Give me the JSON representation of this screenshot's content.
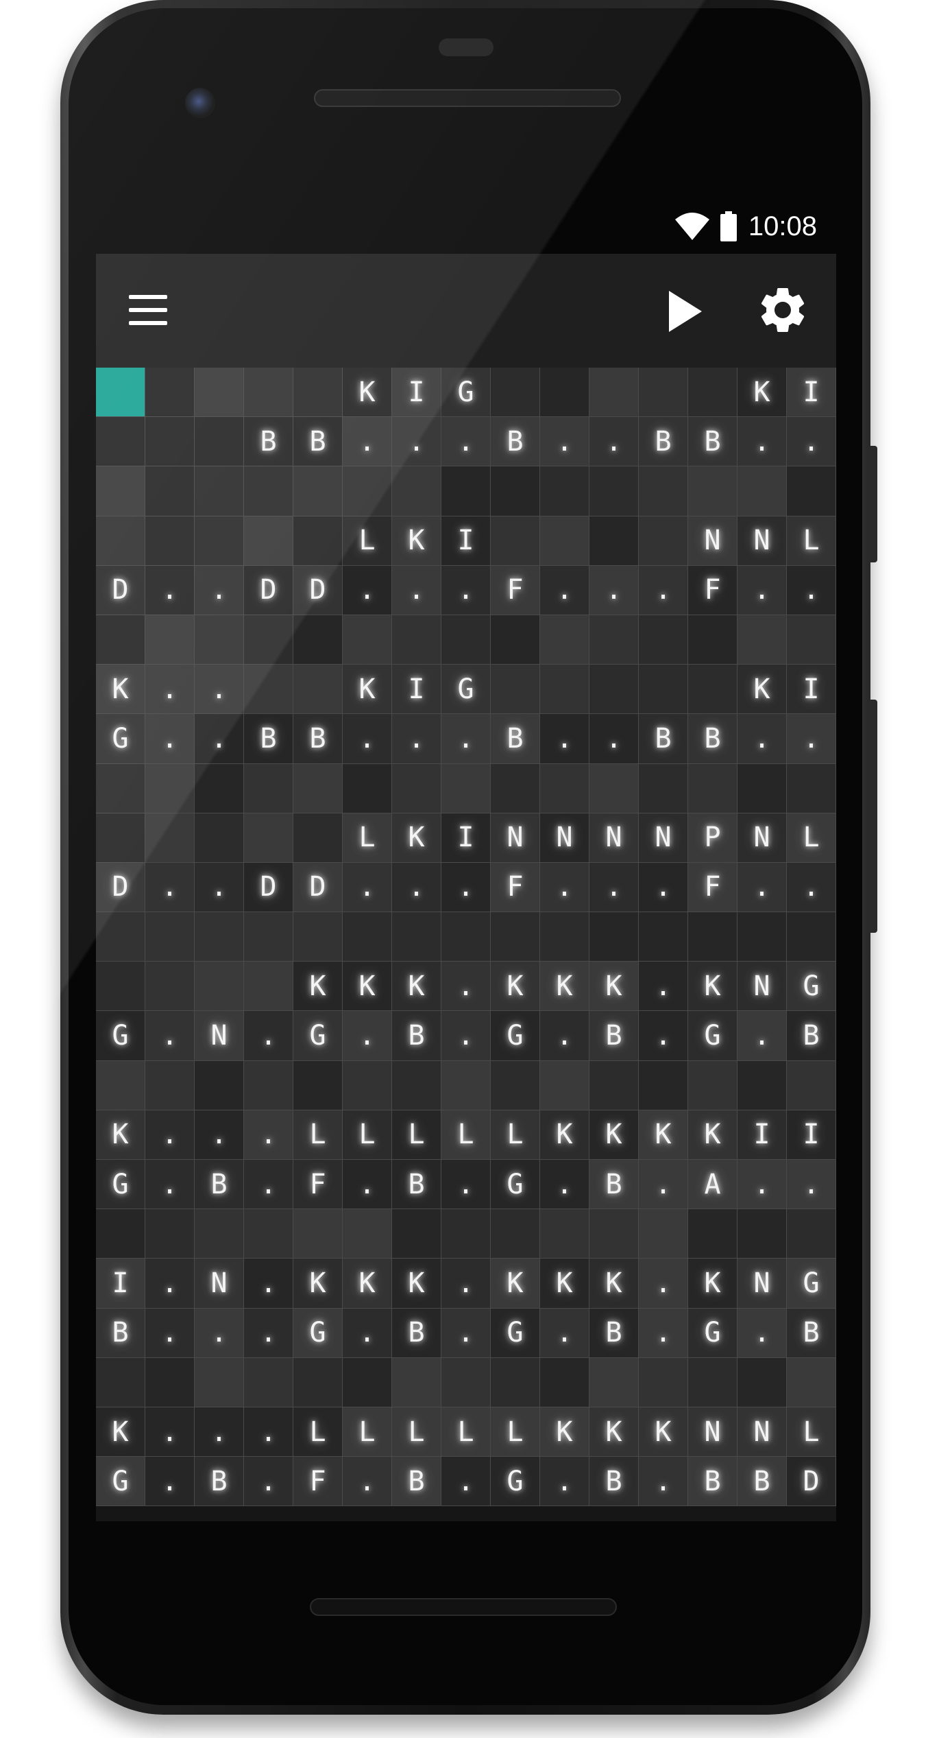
{
  "status_bar": {
    "time": "10:08"
  },
  "toolbar": {
    "icons": [
      "menu-icon",
      "play-icon",
      "settings-icon"
    ]
  },
  "accent_color": "#1aa394",
  "grid": {
    "columns": 15,
    "rows": [
      [
        "",
        "",
        "",
        "",
        "",
        "K",
        "I",
        "G",
        "",
        "",
        "",
        "",
        "",
        "K",
        "I"
      ],
      [
        "",
        "",
        "",
        "B",
        "B",
        ".",
        ".",
        ".",
        "B",
        ".",
        ".",
        "B",
        "B",
        ".",
        "."
      ],
      [
        "",
        "",
        "",
        "",
        "",
        "",
        "",
        "",
        "",
        "",
        "",
        "",
        "",
        "",
        ""
      ],
      [
        "",
        "",
        "",
        "",
        "",
        "L",
        "K",
        "I",
        "",
        "",
        "",
        "",
        "N",
        "N",
        "L"
      ],
      [
        "D",
        ".",
        ".",
        "D",
        "D",
        ".",
        ".",
        ".",
        "F",
        ".",
        ".",
        ".",
        "F",
        ".",
        "."
      ],
      [
        "",
        "",
        "",
        "",
        "",
        "",
        "",
        "",
        "",
        "",
        "",
        "",
        "",
        "",
        ""
      ],
      [
        "K",
        ".",
        ".",
        "",
        "",
        "K",
        "I",
        "G",
        "",
        "",
        "",
        "",
        "",
        "K",
        "I"
      ],
      [
        "G",
        ".",
        ".",
        "B",
        "B",
        ".",
        ".",
        ".",
        "B",
        ".",
        ".",
        "B",
        "B",
        ".",
        "."
      ],
      [
        "",
        "",
        "",
        "",
        "",
        "",
        "",
        "",
        "",
        "",
        "",
        "",
        "",
        "",
        ""
      ],
      [
        "",
        "",
        "",
        "",
        "",
        "L",
        "K",
        "I",
        "N",
        "N",
        "N",
        "N",
        "P",
        "N",
        "L"
      ],
      [
        "D",
        ".",
        ".",
        "D",
        "D",
        ".",
        ".",
        ".",
        "F",
        ".",
        ".",
        ".",
        "F",
        ".",
        "."
      ],
      [
        "",
        "",
        "",
        "",
        "",
        "",
        "",
        "",
        "",
        "",
        "",
        "",
        "",
        "",
        ""
      ],
      [
        "",
        "",
        "",
        "",
        "K",
        "K",
        "K",
        ".",
        "K",
        "K",
        "K",
        ".",
        "K",
        "N",
        "G"
      ],
      [
        "G",
        ".",
        "N",
        ".",
        "G",
        ".",
        "B",
        ".",
        "G",
        ".",
        "B",
        ".",
        "G",
        ".",
        "B"
      ],
      [
        "",
        "",
        "",
        "",
        "",
        "",
        "",
        "",
        "",
        "",
        "",
        "",
        "",
        "",
        ""
      ],
      [
        "K",
        ".",
        ".",
        ".",
        "L",
        "L",
        "L",
        "L",
        "L",
        "K",
        "K",
        "K",
        "K",
        "I",
        "I"
      ],
      [
        "G",
        ".",
        "B",
        ".",
        "F",
        ".",
        "B",
        ".",
        "G",
        ".",
        "B",
        ".",
        "A",
        ".",
        "."
      ],
      [
        "",
        "",
        "",
        "",
        "",
        "",
        "",
        "",
        "",
        "",
        "",
        "",
        "",
        "",
        ""
      ],
      [
        "I",
        ".",
        "N",
        ".",
        "K",
        "K",
        "K",
        ".",
        "K",
        "K",
        "K",
        ".",
        "K",
        "N",
        "G"
      ],
      [
        "B",
        ".",
        ".",
        ".",
        "G",
        ".",
        "B",
        ".",
        "G",
        ".",
        "B",
        ".",
        "G",
        ".",
        "B"
      ],
      [
        "",
        "",
        "",
        "",
        "",
        "",
        "",
        "",
        "",
        "",
        "",
        "",
        "",
        "",
        ""
      ],
      [
        "K",
        ".",
        ".",
        ".",
        "L",
        "L",
        "L",
        "L",
        "L",
        "K",
        "K",
        "K",
        "N",
        "N",
        "L"
      ],
      [
        "G",
        ".",
        "B",
        ".",
        "F",
        ".",
        "B",
        ".",
        "G",
        ".",
        "B",
        ".",
        "B",
        "B",
        "D"
      ]
    ]
  }
}
